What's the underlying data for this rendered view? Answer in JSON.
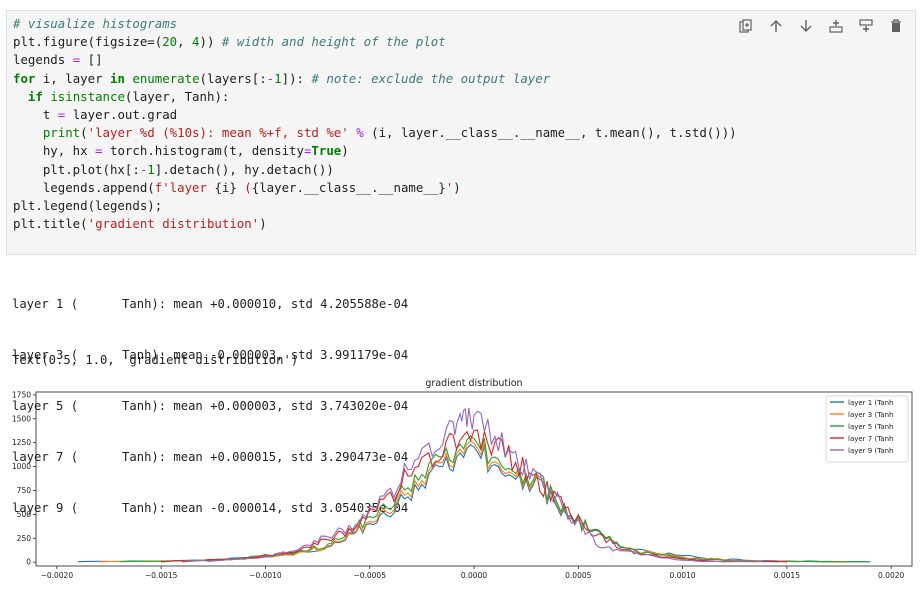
{
  "cell": {
    "toolbar": [
      {
        "name": "duplicate-cell-icon",
        "label": "Duplicate"
      },
      {
        "name": "move-up-icon",
        "label": "Move up"
      },
      {
        "name": "move-down-icon",
        "label": "Move down"
      },
      {
        "name": "insert-above-icon",
        "label": "Insert above"
      },
      {
        "name": "insert-below-icon",
        "label": "Insert below"
      },
      {
        "name": "delete-icon",
        "label": "Delete"
      }
    ]
  },
  "output": {
    "lines": [
      "layer 1 (      Tanh): mean +0.000010, std 4.205588e-04",
      "layer 3 (      Tanh): mean -0.000003, std 3.991179e-04",
      "layer 5 (      Tanh): mean +0.000003, std 3.743020e-04",
      "layer 7 (      Tanh): mean +0.000015, std 3.290473e-04",
      "layer 9 (      Tanh): mean -0.000014, std 3.054035e-04"
    ],
    "result": "Text(0.5, 1.0, 'gradient distribution')"
  },
  "chart_data": {
    "type": "line",
    "title": "gradient distribution",
    "xlim": [
      -0.0021,
      0.0021
    ],
    "ylim": [
      -40,
      1780
    ],
    "xticks": [
      "−0.0020",
      "−0.0015",
      "−0.0010",
      "−0.0005",
      "0.0000",
      "0.0005",
      "0.0010",
      "0.0015",
      "0.0020"
    ],
    "xtick_values": [
      -0.002,
      -0.0015,
      -0.001,
      -0.0005,
      0,
      0.0005,
      0.001,
      0.0015,
      0.002
    ],
    "yticks": [
      "0",
      "250",
      "500",
      "750",
      "1000",
      "1250",
      "1500",
      "1750"
    ],
    "ytick_values": [
      0,
      250,
      500,
      750,
      1000,
      1250,
      1500,
      1750
    ],
    "legend_position": "top-right",
    "series": [
      {
        "name": "layer 1 (Tanh",
        "color": "#1f77b4",
        "x": [
          -0.0019,
          -0.0016,
          -0.0013,
          -0.0011,
          -0.0009,
          -0.0007,
          -0.0006,
          -0.0005,
          -0.0004,
          -0.0003,
          -0.0002,
          -0.0001,
          0.0,
          0.0001,
          0.0002,
          0.0003,
          0.0004,
          0.0005,
          0.0006,
          0.0007,
          0.0009,
          0.0011,
          0.0013,
          0.0016,
          0.0019
        ],
        "y": [
          5,
          10,
          20,
          40,
          80,
          160,
          260,
          380,
          560,
          760,
          940,
          1060,
          1130,
          1040,
          920,
          780,
          590,
          420,
          280,
          180,
          90,
          40,
          20,
          8,
          4
        ]
      },
      {
        "name": "layer 3 (Tanh",
        "color": "#ff7f0e",
        "x": [
          -0.0018,
          -0.0015,
          -0.0012,
          -0.001,
          -0.0008,
          -0.0007,
          -0.0006,
          -0.0005,
          -0.0004,
          -0.0003,
          -0.0002,
          -0.0001,
          0.0,
          0.0001,
          0.0002,
          0.0003,
          0.0004,
          0.0005,
          0.0006,
          0.0007,
          0.0008,
          0.001,
          0.0012,
          0.0015,
          0.0018
        ],
        "y": [
          4,
          10,
          25,
          45,
          110,
          170,
          270,
          400,
          600,
          800,
          980,
          1100,
          1170,
          1070,
          950,
          800,
          620,
          430,
          290,
          190,
          110,
          50,
          25,
          8,
          3
        ]
      },
      {
        "name": "layer 5 (Tanh",
        "color": "#2ca02c",
        "x": [
          -0.0017,
          -0.0014,
          -0.0012,
          -0.001,
          -0.0008,
          -0.0007,
          -0.0006,
          -0.0005,
          -0.0004,
          -0.0003,
          -0.0002,
          -0.0001,
          0.0,
          0.0001,
          0.0002,
          0.0003,
          0.0004,
          0.0005,
          0.0006,
          0.0007,
          0.0008,
          0.001,
          0.0012,
          0.0015,
          0.0019
        ],
        "y": [
          5,
          12,
          30,
          60,
          120,
          190,
          300,
          450,
          650,
          860,
          1050,
          1150,
          1220,
          1120,
          980,
          830,
          640,
          440,
          290,
          190,
          100,
          40,
          18,
          6,
          2
        ]
      },
      {
        "name": "layer 7 (Tanh",
        "color": "#d62728",
        "x": [
          -0.0015,
          -0.0013,
          -0.0011,
          -0.0009,
          -0.0008,
          -0.0007,
          -0.0006,
          -0.0005,
          -0.0004,
          -0.0003,
          -0.0002,
          -0.0001,
          0.0,
          0.0001,
          0.0002,
          0.0003,
          0.0004,
          0.0005,
          0.0006,
          0.0007,
          0.0008,
          0.001,
          0.0012,
          0.0015
        ],
        "y": [
          6,
          18,
          40,
          90,
          150,
          230,
          330,
          500,
          720,
          930,
          1120,
          1260,
          1340,
          1200,
          1050,
          870,
          650,
          430,
          270,
          160,
          80,
          30,
          10,
          4
        ]
      },
      {
        "name": "layer 9 (Tanh",
        "color": "#9467bd",
        "x": [
          -0.0014,
          -0.0012,
          -0.001,
          -0.0009,
          -0.0008,
          -0.0007,
          -0.0006,
          -0.0005,
          -0.0004,
          -0.0003,
          -0.0002,
          -0.0001,
          -5e-05,
          0.0,
          0.0001,
          0.0002,
          0.0003,
          0.0004,
          0.0005,
          0.0006,
          0.0007,
          0.0009,
          0.0011,
          0.0014
        ],
        "y": [
          5,
          20,
          50,
          100,
          170,
          260,
          360,
          520,
          760,
          1000,
          1230,
          1400,
          1550,
          1480,
          1320,
          1100,
          880,
          640,
          400,
          180,
          120,
          40,
          12,
          4
        ]
      }
    ]
  }
}
